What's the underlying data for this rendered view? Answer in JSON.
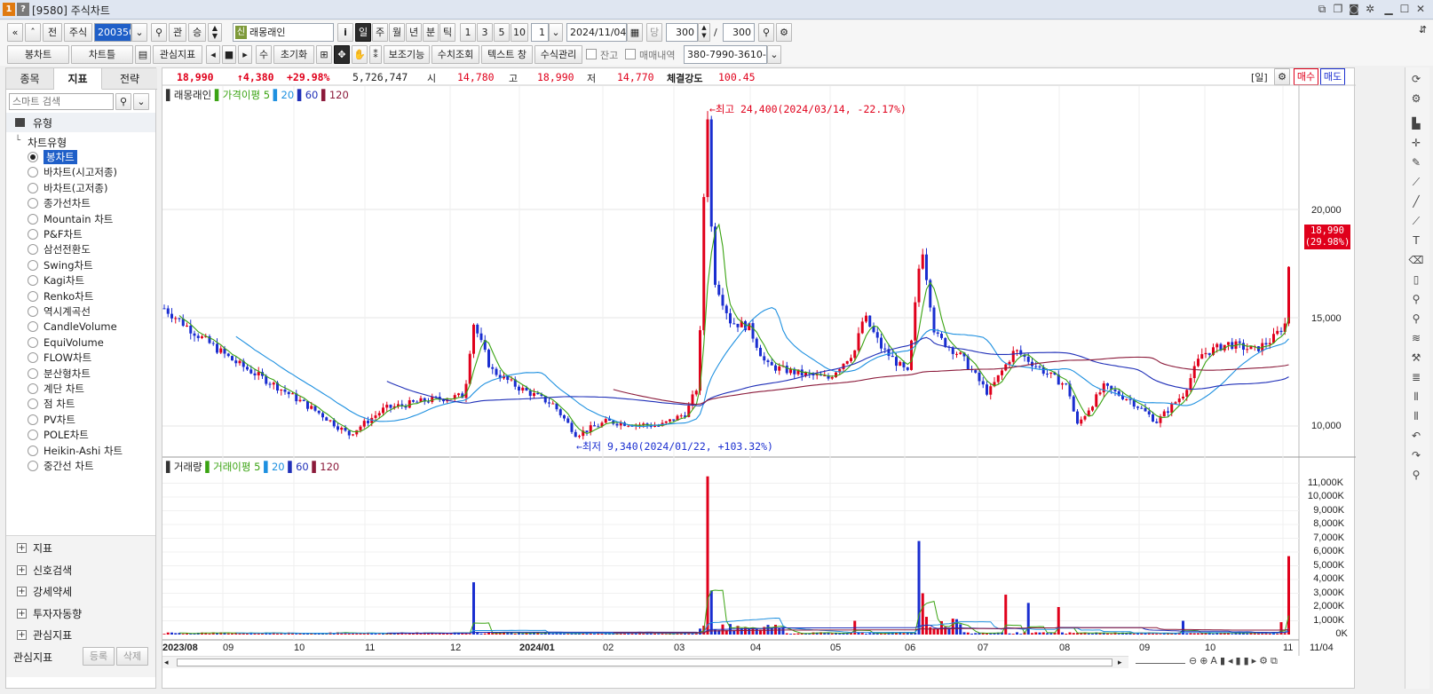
{
  "window": {
    "logo1": "1",
    "logo2": "?",
    "title": "[9580] 주식차트"
  },
  "toolbar1": {
    "nav_first": "«",
    "nav_up": "ˆ",
    "prev_label": "전",
    "market_label": "주식",
    "code_value": "200350",
    "interest_label": "관",
    "up_label": "승",
    "stock_badge": "신",
    "stock_name": "래몽래인",
    "info_label": "i",
    "periods": [
      "일",
      "주",
      "월",
      "년",
      "분",
      "틱"
    ],
    "selected_period": "일",
    "intervals": [
      "1",
      "3",
      "5",
      "10"
    ],
    "count_value": "1",
    "date_value": "2024/11/04",
    "dang_label": "당",
    "view_count": "300",
    "slash": "/",
    "total_count": "300"
  },
  "toolbar2": {
    "chart_type_label": "봉차트",
    "chart_frame_label": "차트틀",
    "interest_indicator_label": "관심지표",
    "su_label": "수",
    "reset_label": "초기화",
    "aux_label": "보조기능",
    "num_query_label": "수치조회",
    "text_window_label": "텍스트 창",
    "formula_label": "수식관리",
    "balance_label": "잔고",
    "trade_label": "매매내역",
    "account_value": "380-7990-3610-1"
  },
  "left": {
    "tabs": [
      "종목",
      "지표",
      "전략"
    ],
    "active_tab": "지표",
    "search_placeholder": "스마트 검색",
    "group_title": "유형",
    "subgroup_title": "차트유형",
    "chart_types": [
      "봉차트",
      "바차트(시고저종)",
      "바차트(고저종)",
      "종가선차트",
      "Mountain 차트",
      "P&F차트",
      "삼선전환도",
      "Swing차트",
      "Kagi차트",
      "Renko차트",
      "역시계곡선",
      "CandleVolume",
      "EquiVolume",
      "FLOW차트",
      "분산형차트",
      "계단 차트",
      "점 차트",
      "PV차트",
      "POLE차트",
      "Heikin-Ashi 차트",
      "중간선 차트"
    ],
    "selected_type": "봉차트",
    "sections": [
      "지표",
      "신호검색",
      "강세약세",
      "투자자동향",
      "관심지표"
    ],
    "footer_label": "관심지표",
    "register_label": "등록",
    "delete_label": "삭제"
  },
  "quote": {
    "price": "18,990",
    "change": "↑4,380",
    "change_pct": "+29.98%",
    "volume": "5,726,747",
    "open_label": "시",
    "open": "14,780",
    "high_label": "고",
    "high": "18,990",
    "low_label": "저",
    "low": "14,770",
    "strength_label": "체결강도",
    "strength": "100.45",
    "period_tag": "[일]",
    "buy_label": "매수",
    "sell_label": "매도"
  },
  "price_panel": {
    "name": "래몽래인",
    "ma_label": "가격이평",
    "ma_periods": [
      "5",
      "20",
      "60",
      "120"
    ],
    "high_annotation": "←최고 24,400(2024/03/14, -22.17%)",
    "low_annotation": "←최저 9,340(2024/01/22, +103.32%)",
    "last_price_tag": "18,990",
    "last_pct_tag": "(29.98%)",
    "y_ticks": [
      "20,000",
      "15,000",
      "10,000"
    ]
  },
  "volume_panel": {
    "name": "거래량",
    "ma_label": "거래이평",
    "ma_periods": [
      "5",
      "20",
      "60",
      "120"
    ],
    "y_ticks": [
      "11,000K",
      "10,000K",
      "9,000K",
      "8,000K",
      "7,000K",
      "6,000K",
      "5,000K",
      "4,000K",
      "3,000K",
      "2,000K",
      "1,000K",
      "0K"
    ]
  },
  "x_axis": {
    "labels": [
      "2023/08",
      "09",
      "10",
      "11",
      "12",
      "2024/01",
      "02",
      "03",
      "04",
      "05",
      "06",
      "07",
      "08",
      "09",
      "10",
      "11"
    ],
    "last_date": "11/04"
  },
  "colors": {
    "up": "#e0001b",
    "down": "#1a2ed0",
    "ma5": "#3aa312",
    "ma20": "#1e90e0",
    "ma60": "#1f2fb8",
    "ma120": "#8b1a3a",
    "accent": "#1f5fc8"
  }
}
